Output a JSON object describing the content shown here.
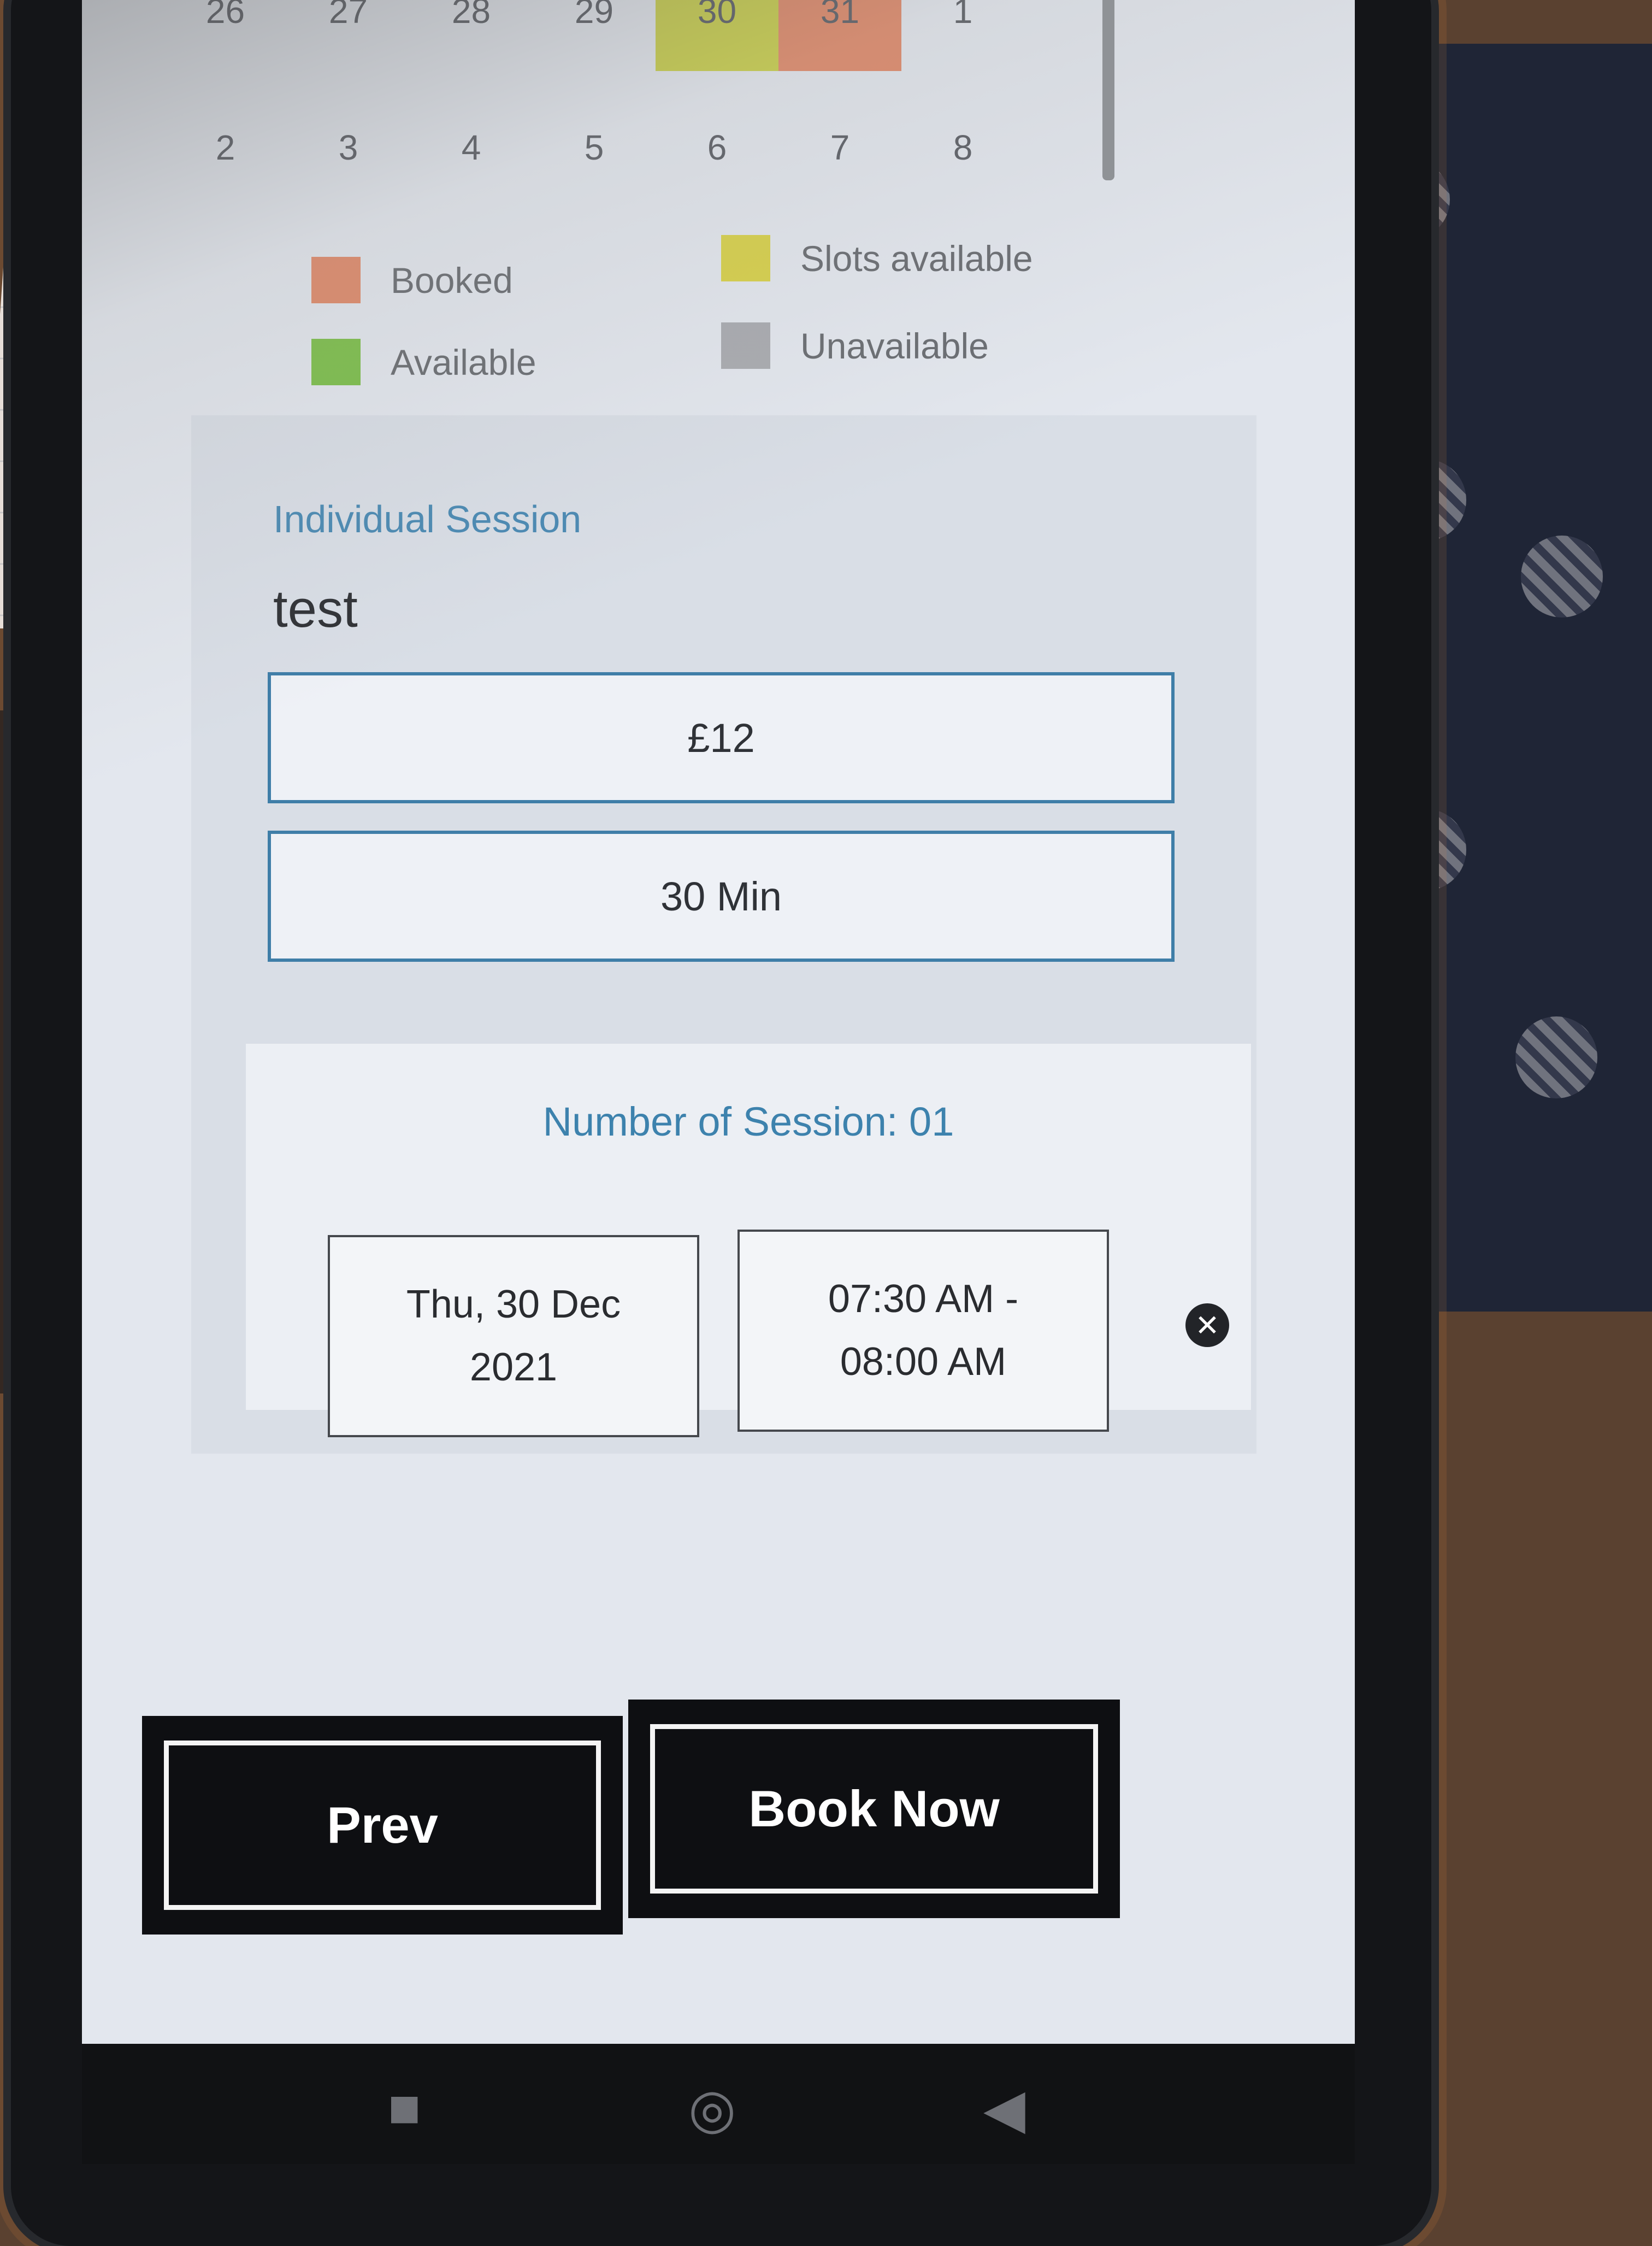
{
  "calendar": {
    "week1": [
      "26",
      "27",
      "28",
      "29",
      "30",
      "31",
      "1"
    ],
    "week2": [
      "2",
      "3",
      "4",
      "5",
      "6",
      "7",
      "8"
    ],
    "day_status": {
      "30": "slots-available",
      "31": "booked"
    }
  },
  "legend": {
    "booked": "Booked",
    "available": "Available",
    "slots_available": "Slots available",
    "unavailable": "Unavailable"
  },
  "colors": {
    "booked": "#e08a6a",
    "available": "#7cbf4a",
    "slots_available": "#d8d14a",
    "unavailable": "#a9abb0",
    "accent": "#3d82ad",
    "button": "#0e0f12"
  },
  "session": {
    "type": "Individual Session",
    "name": "test",
    "price": "£12",
    "duration": "30 Min",
    "count_label": "Number of Session: 01",
    "date": "Thu, 30 Dec 2021",
    "time": "07:30 AM - 08:00 AM"
  },
  "actions": {
    "prev_label": "Prev",
    "book_label": "Book Now"
  },
  "icons": {
    "remove": "close-circle-icon",
    "nav_recents": "square-icon",
    "nav_home": "circle-icon",
    "nav_back": "triangle-back-icon"
  }
}
